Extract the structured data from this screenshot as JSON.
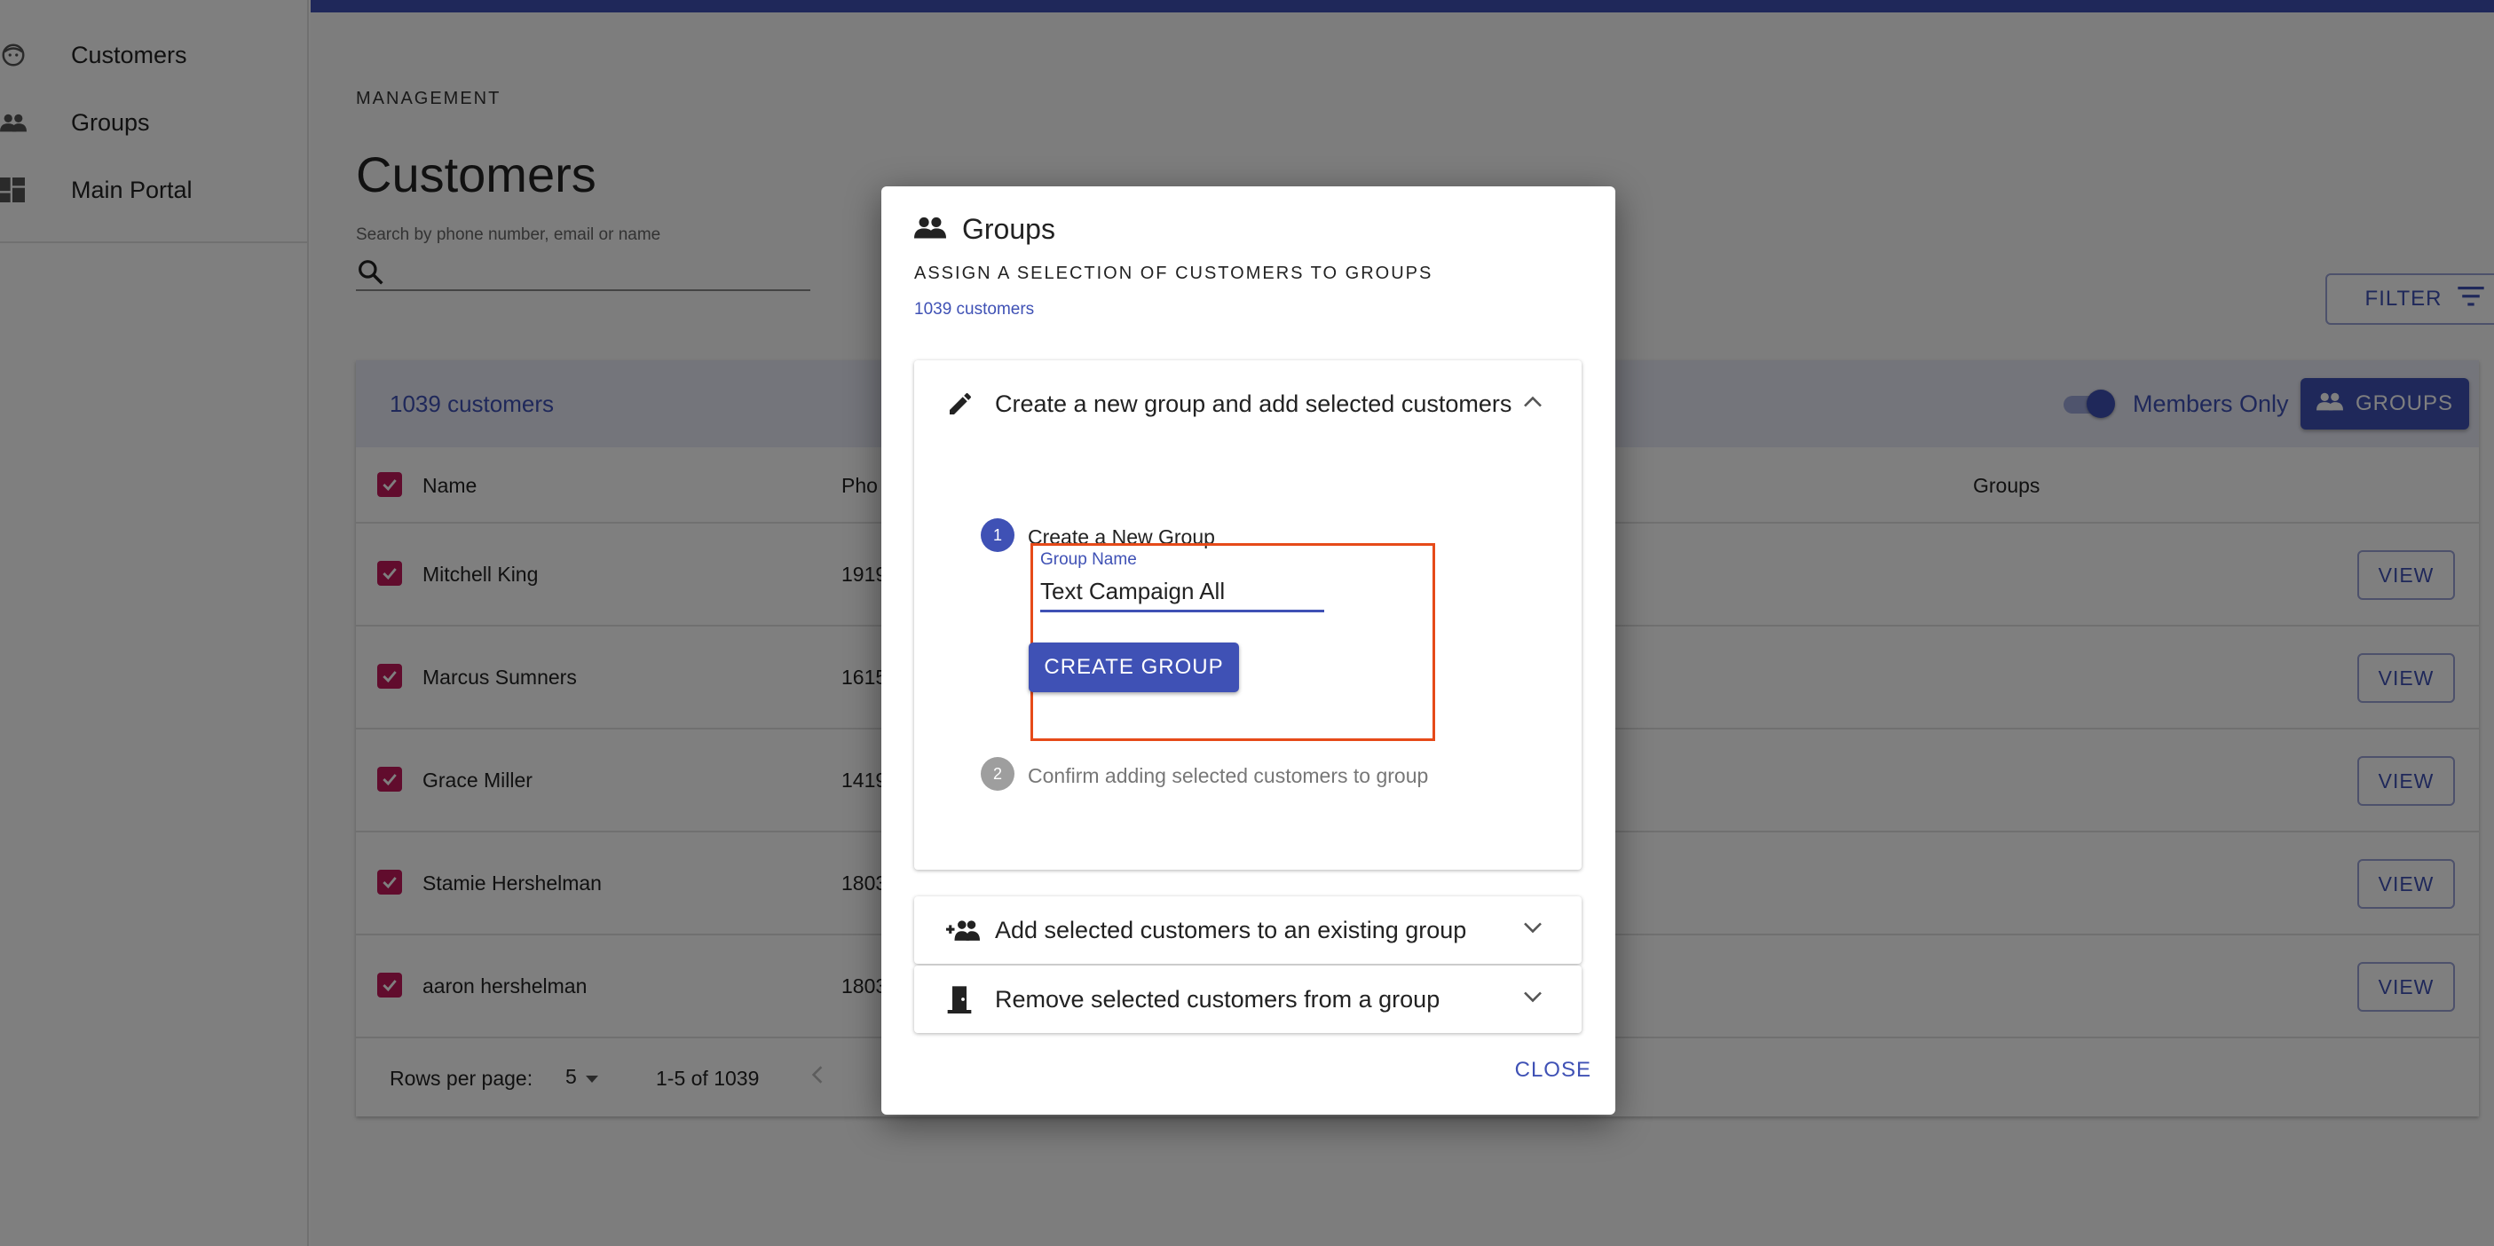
{
  "sidebar": {
    "items": [
      {
        "label": "Customers",
        "icon": "face-icon"
      },
      {
        "label": "Groups",
        "icon": "people-icon"
      },
      {
        "label": "Main Portal",
        "icon": "dashboard-icon"
      }
    ]
  },
  "header": {
    "overline": "MANAGEMENT",
    "title": "Customers"
  },
  "search": {
    "label": "Search by phone number, email or name",
    "value": ""
  },
  "toolbar": {
    "filter_label": "FILTER",
    "count_text": "1039 customers",
    "members_only_label": "Members Only",
    "members_only_on": true,
    "groups_label": "GROUPS"
  },
  "table": {
    "columns": [
      "Name",
      "Pho",
      "Groups"
    ],
    "rows": [
      {
        "name": "Mitchell King",
        "phone": "1919",
        "action": "VIEW"
      },
      {
        "name": "Marcus Sumners",
        "phone": "1615",
        "action": "VIEW"
      },
      {
        "name": "Grace Miller",
        "phone": "1419",
        "action": "VIEW"
      },
      {
        "name": "Stamie Hershelman",
        "phone": "1803",
        "action": "VIEW"
      },
      {
        "name": "aaron hershelman",
        "phone": "1803",
        "action": "VIEW"
      }
    ],
    "footer": {
      "rows_per_page_label": "Rows per page:",
      "rows_per_page": "5",
      "range": "1-5 of 1039"
    }
  },
  "dialog": {
    "title": "Groups",
    "subtitle": "ASSIGN A SELECTION OF CUSTOMERS TO GROUPS",
    "count": "1039 customers",
    "panels": [
      {
        "label": "Create a new group and add selected customers",
        "expanded": true
      },
      {
        "label": "Add selected customers to an existing group",
        "expanded": false
      },
      {
        "label": "Remove selected customers from a group",
        "expanded": false
      }
    ],
    "steps": [
      {
        "number": "1",
        "label": "Create a New Group"
      },
      {
        "number": "2",
        "label": "Confirm adding selected customers to group"
      }
    ],
    "group_name_label": "Group Name",
    "group_name_value": "Text Campaign All",
    "create_button": "CREATE GROUP",
    "close_button": "CLOSE"
  },
  "colors": {
    "primary": "#3f51b5",
    "checkbox": "#c2185b",
    "highlight": "#e64a19"
  }
}
